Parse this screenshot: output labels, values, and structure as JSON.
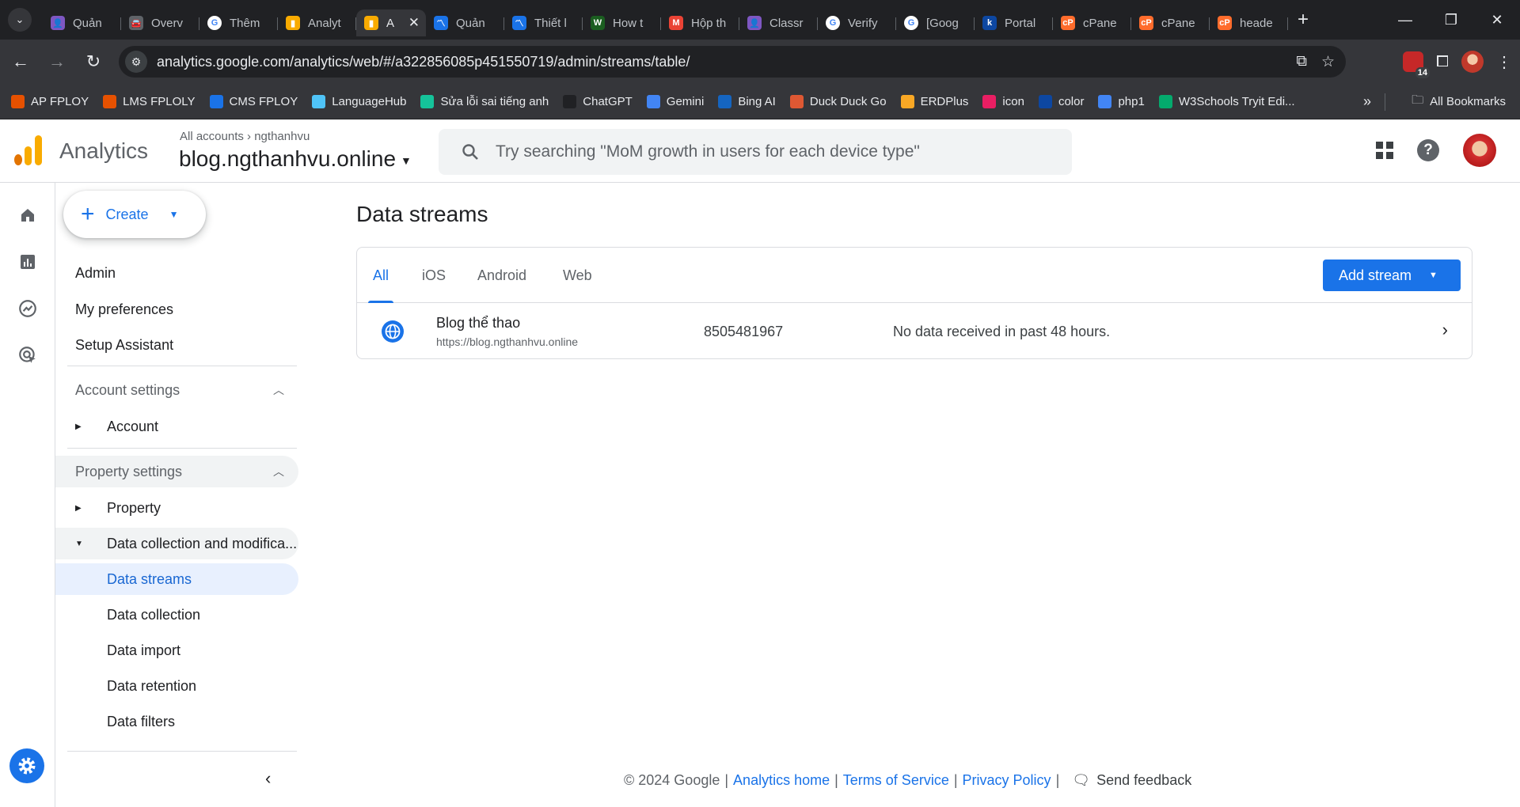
{
  "browser": {
    "tabs": [
      {
        "title": "Quản",
        "color": "#7e57c2",
        "glyph": "👤"
      },
      {
        "title": "Overv",
        "color": "#5f6368",
        "glyph": "🚘"
      },
      {
        "title": "Thêm",
        "color": "#ffffff",
        "glyph": "G"
      },
      {
        "title": "Analyt",
        "color": "#f9ab00",
        "glyph": "▮"
      },
      {
        "title": "A",
        "color": "#f9ab00",
        "glyph": "▮",
        "active": true
      },
      {
        "title": "Quản",
        "color": "#1a73e8",
        "glyph": "〽"
      },
      {
        "title": "Thiết l",
        "color": "#1a73e8",
        "glyph": "〽"
      },
      {
        "title": "How t",
        "color": "#1b5e20",
        "glyph": "W"
      },
      {
        "title": "Hộp th",
        "color": "#ea4335",
        "glyph": "M"
      },
      {
        "title": "Classr",
        "color": "#7e57c2",
        "glyph": "👤"
      },
      {
        "title": "Verify",
        "color": "#ffffff",
        "glyph": "G"
      },
      {
        "title": "[Goog",
        "color": "#ffffff",
        "glyph": "G"
      },
      {
        "title": "Portal",
        "color": "#0d47a1",
        "glyph": "k"
      },
      {
        "title": "cPane",
        "color": "#ff6c2c",
        "glyph": "cP"
      },
      {
        "title": "cPane",
        "color": "#ff6c2c",
        "glyph": "cP"
      },
      {
        "title": "heade",
        "color": "#ff6c2c",
        "glyph": "cP"
      }
    ],
    "url_host": "analytics.google.com",
    "url_path": "/analytics/web/#/a322856085p451550719/admin/streams/table/",
    "extension_badge": "14",
    "bookmarks": [
      {
        "label": "AP FPLOY",
        "color": "#e65100"
      },
      {
        "label": "LMS FPLOLY",
        "color": "#e65100"
      },
      {
        "label": "CMS FPLOY",
        "color": "#1a73e8"
      },
      {
        "label": "LanguageHub",
        "color": "#4fc3f7"
      },
      {
        "label": "Sửa lỗi sai tiếng anh",
        "color": "#15c39a"
      },
      {
        "label": "ChatGPT",
        "color": "#202124"
      },
      {
        "label": "Gemini",
        "color": "#4285f4"
      },
      {
        "label": "Bing AI",
        "color": "#1565c0"
      },
      {
        "label": "Duck Duck Go",
        "color": "#de5833"
      },
      {
        "label": "ERDPlus",
        "color": "#f9a825"
      },
      {
        "label": "icon",
        "color": "#e91e63"
      },
      {
        "label": "color",
        "color": "#0d47a1"
      },
      {
        "label": "php1",
        "color": "#4285f4"
      },
      {
        "label": "W3Schools Tryit Edi...",
        "color": "#04aa6d"
      }
    ],
    "all_bookmarks_label": "All Bookmarks"
  },
  "header": {
    "product": "Analytics",
    "crumb_root": "All accounts",
    "crumb_account": "ngthanhvu",
    "property": "blog.ngthanhvu.online",
    "search_placeholder": "Try searching \"MoM growth in users for each device type\""
  },
  "nav": {
    "create_label": "Create",
    "admin": "Admin",
    "my_preferences": "My preferences",
    "setup_assistant": "Setup Assistant",
    "account_settings": "Account settings",
    "account": "Account",
    "property_settings": "Property settings",
    "property": "Property",
    "data_collection_mod": "Data collection and modifica...",
    "items": [
      "Data streams",
      "Data collection",
      "Data import",
      "Data retention",
      "Data filters"
    ]
  },
  "main": {
    "title": "Data streams",
    "tabs": [
      "All",
      "iOS",
      "Android",
      "Web"
    ],
    "add_stream_label": "Add stream",
    "streams": [
      {
        "name": "Blog thể thao",
        "url": "https://blog.ngthanhvu.online",
        "id": "8505481967",
        "status": "No data received in past 48 hours."
      }
    ]
  },
  "footer": {
    "copyright": "© 2024 Google",
    "analytics_home": "Analytics home",
    "terms": "Terms of Service",
    "privacy": "Privacy Policy",
    "feedback": "Send feedback"
  },
  "colors": {
    "accent": "#1a73e8",
    "ga_orange": "#f9ab00",
    "ga_dark_orange": "#e37400"
  }
}
